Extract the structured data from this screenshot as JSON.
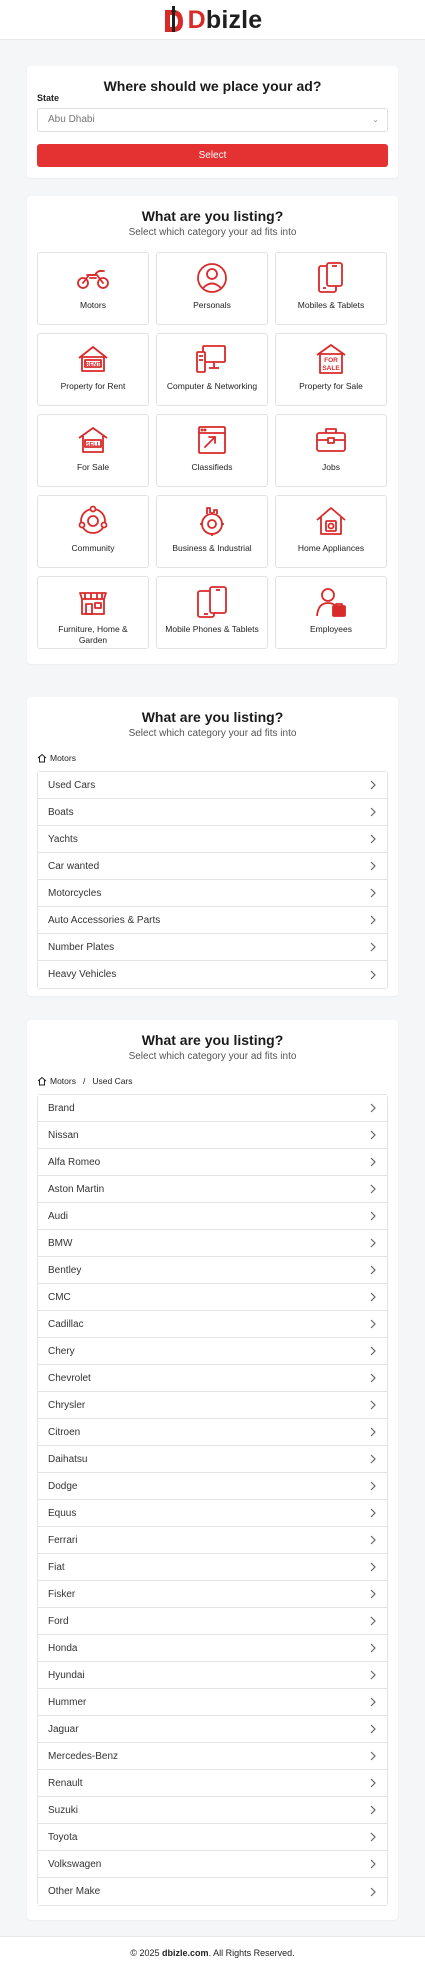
{
  "header": {
    "logo_prefix": "D",
    "logo_rest": "bizle",
    "brand_color": "#d92a2a"
  },
  "place_ad": {
    "title": "Where should we place your ad?",
    "state_label": "State",
    "state_value": "Abu Dhabi",
    "select_button": "Select",
    "button_color": "#e43131"
  },
  "categories": {
    "title": "What are you listing?",
    "subtitle": "Select which category your ad fits into",
    "items": [
      {
        "label": "Motors",
        "icon": "motorcycle-icon"
      },
      {
        "label": "Personals",
        "icon": "person-icon"
      },
      {
        "label": "Mobiles & Tablets",
        "icon": "mobile-tablet-icon"
      },
      {
        "label": "Property for Rent",
        "icon": "house-rent-icon"
      },
      {
        "label": "Computer & Networking",
        "icon": "computer-icon"
      },
      {
        "label": "Property for Sale",
        "icon": "house-sale-icon"
      },
      {
        "label": "For Sale",
        "icon": "sell-house-icon"
      },
      {
        "label": "Classifieds",
        "icon": "classifieds-icon"
      },
      {
        "label": "Jobs",
        "icon": "briefcase-icon"
      },
      {
        "label": "Community",
        "icon": "community-icon"
      },
      {
        "label": "Business & Industrial",
        "icon": "factory-gear-icon"
      },
      {
        "label": "Home Appliances",
        "icon": "home-appliances-icon"
      },
      {
        "label": "Furniture, Home & Garden",
        "icon": "garden-store-icon"
      },
      {
        "label": "Mobile Phones & Tablets",
        "icon": "phones-icon"
      },
      {
        "label": "Employees",
        "icon": "employee-icon"
      }
    ]
  },
  "motors": {
    "title": "What are you listing?",
    "subtitle": "Select which category your ad fits into",
    "breadcrumb": [
      "Motors"
    ],
    "items": [
      "Used Cars",
      "Boats",
      "Yachts",
      "Car wanted",
      "Motorcycles",
      "Auto Accessories & Parts",
      "Number Plates",
      "Heavy Vehicles"
    ]
  },
  "used_cars": {
    "title": "What are you listing?",
    "subtitle": "Select which category your ad fits into",
    "breadcrumb": [
      "Motors",
      "Used Cars"
    ],
    "separator": "/",
    "items": [
      "Brand",
      "Nissan",
      "Alfa Romeo",
      "Aston Martin",
      "Audi",
      "BMW",
      "Bentley",
      "CMC",
      "Cadillac",
      "Chery",
      "Chevrolet",
      "Chrysler",
      "Citroen",
      "Daihatsu",
      "Dodge",
      "Equus",
      "Ferrari",
      "Fiat",
      "Fisker",
      "Ford",
      "Honda",
      "Hyundai",
      "Hummer",
      "Jaguar",
      "Mercedes-Benz",
      "Renault",
      "Suzuki",
      "Toyota",
      "Volkswagen",
      "Other Make"
    ]
  },
  "footer": {
    "prefix": "© 2025 ",
    "site": "dbizle.com",
    "suffix": ". All Rights Reserved."
  }
}
